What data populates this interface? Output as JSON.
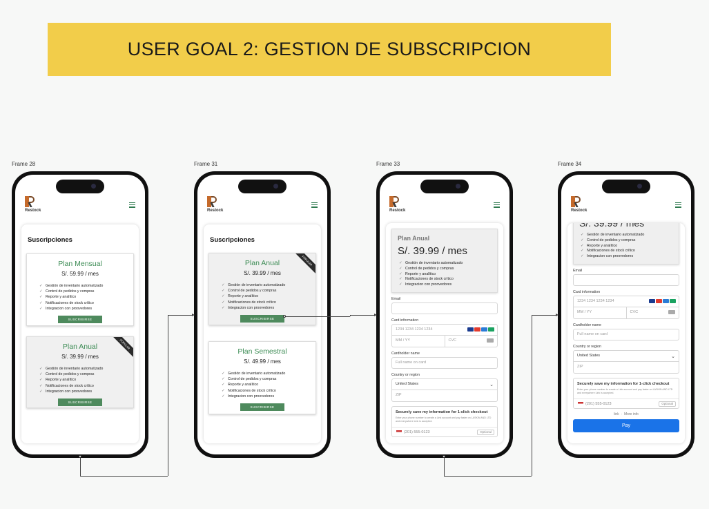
{
  "title": "USER GOAL 2: GESTION DE SUBSCRIPCION",
  "brand": "Restock",
  "frames": {
    "f28": "Frame 28",
    "f31": "Frame 31",
    "f33": "Frame 33",
    "f34": "Frame 34"
  },
  "subs_title": "Suscripciones",
  "features": [
    "Gestión de inventario automatizado",
    "Control de pedidos y compras",
    "Reporte y analítico",
    "Notificaciones de stock crítico",
    "Integracion con proovedores"
  ],
  "subscribe_label": "SUSCRIBIRSE",
  "ribbon_label": "POPULAR",
  "plans": {
    "mensual": {
      "name": "Plan Mensual",
      "price": "S/. 59.99 / mes"
    },
    "anual": {
      "name": "Plan Anual",
      "price": "S/. 39.99 / mes"
    },
    "semestral": {
      "name": "Plan Semestral",
      "price": "S/. 49.99 / mes"
    }
  },
  "checkout": {
    "email_label": "Email",
    "card_label": "Card information",
    "card_placeholder": "1234 1234 1234 1234",
    "expiry_placeholder": "MM / YY",
    "cvc_placeholder": "CVC",
    "holder_label": "Cardholder name",
    "holder_placeholder": "Full name on card",
    "country_label": "Country or region",
    "country_value": "United States",
    "zip_placeholder": "ZIP",
    "save_title": "Securely save my information for 1-click checkout",
    "save_desc": "Enter your phone number to create a Link account and pay faster on LASKIN AND LTD and everywhere Link is accepted.",
    "phone_placeholder": "(201) 555-0123",
    "optional": "Optional",
    "link": "link",
    "more_info": "More info",
    "pay": "Pay",
    "partial_price": "S/. 39.99 / mes"
  },
  "colors": {
    "banner": "#f2cd4a",
    "accent_green": "#4e8a5d",
    "pay_blue": "#1a73e8"
  }
}
